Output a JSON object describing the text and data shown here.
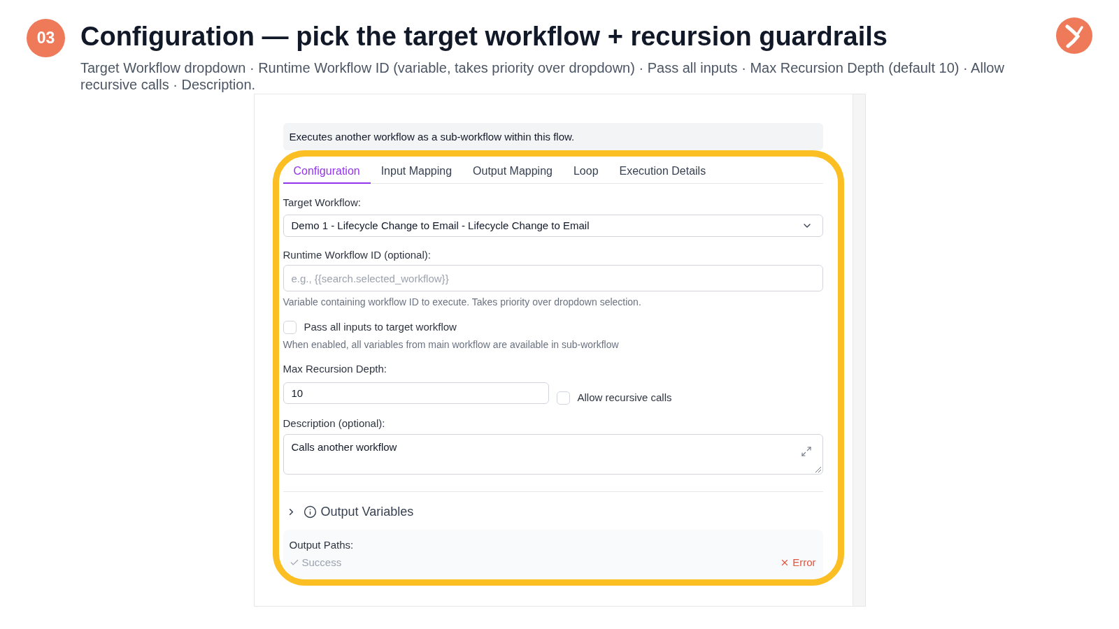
{
  "header": {
    "step": "03",
    "title": "Configuration — pick the target workflow + recursion guardrails",
    "subtitle": "Target Workflow dropdown · Runtime Workflow ID (variable, takes priority over dropdown) · Pass all inputs · Max Recursion Depth (default 10) · Allow recursive calls · Description."
  },
  "panel": {
    "description": "Executes another workflow as a sub-workflow within this flow.",
    "tabs": [
      {
        "label": "Configuration",
        "selected": true
      },
      {
        "label": "Input Mapping",
        "selected": false
      },
      {
        "label": "Output Mapping",
        "selected": false
      },
      {
        "label": "Loop",
        "selected": false
      },
      {
        "label": "Execution Details",
        "selected": false
      }
    ],
    "fields": [
      {
        "kind": "select",
        "label": "Target Workflow:",
        "value": "Demo 1 - Lifecycle Change to Email - Lifecycle Change to Email"
      },
      {
        "kind": "text",
        "label": "Runtime Workflow ID (optional):",
        "placeholder": "e.g., {{search.selected_workflow}}",
        "hint": "Variable containing workflow ID to execute. Takes priority over dropdown selection."
      },
      {
        "kind": "checkbox",
        "label": "Pass all inputs to target workflow",
        "checked": false,
        "hint": "When enabled, all variables from main workflow are available in sub-workflow"
      },
      {
        "kind": "number_with_checkbox",
        "label": "Max Recursion Depth:",
        "value": "10",
        "checkbox": {
          "label": "Allow recursive calls",
          "checked": false
        }
      },
      {
        "kind": "textarea",
        "label": "Description (optional):",
        "value": "Calls another workflow"
      }
    ],
    "output_variables": {
      "label": "Output Variables",
      "expanded": false
    },
    "output_paths": {
      "label": "Output Paths:",
      "paths": [
        {
          "kind": "success",
          "label": "Success"
        },
        {
          "kind": "error",
          "label": "Error"
        }
      ]
    }
  }
}
